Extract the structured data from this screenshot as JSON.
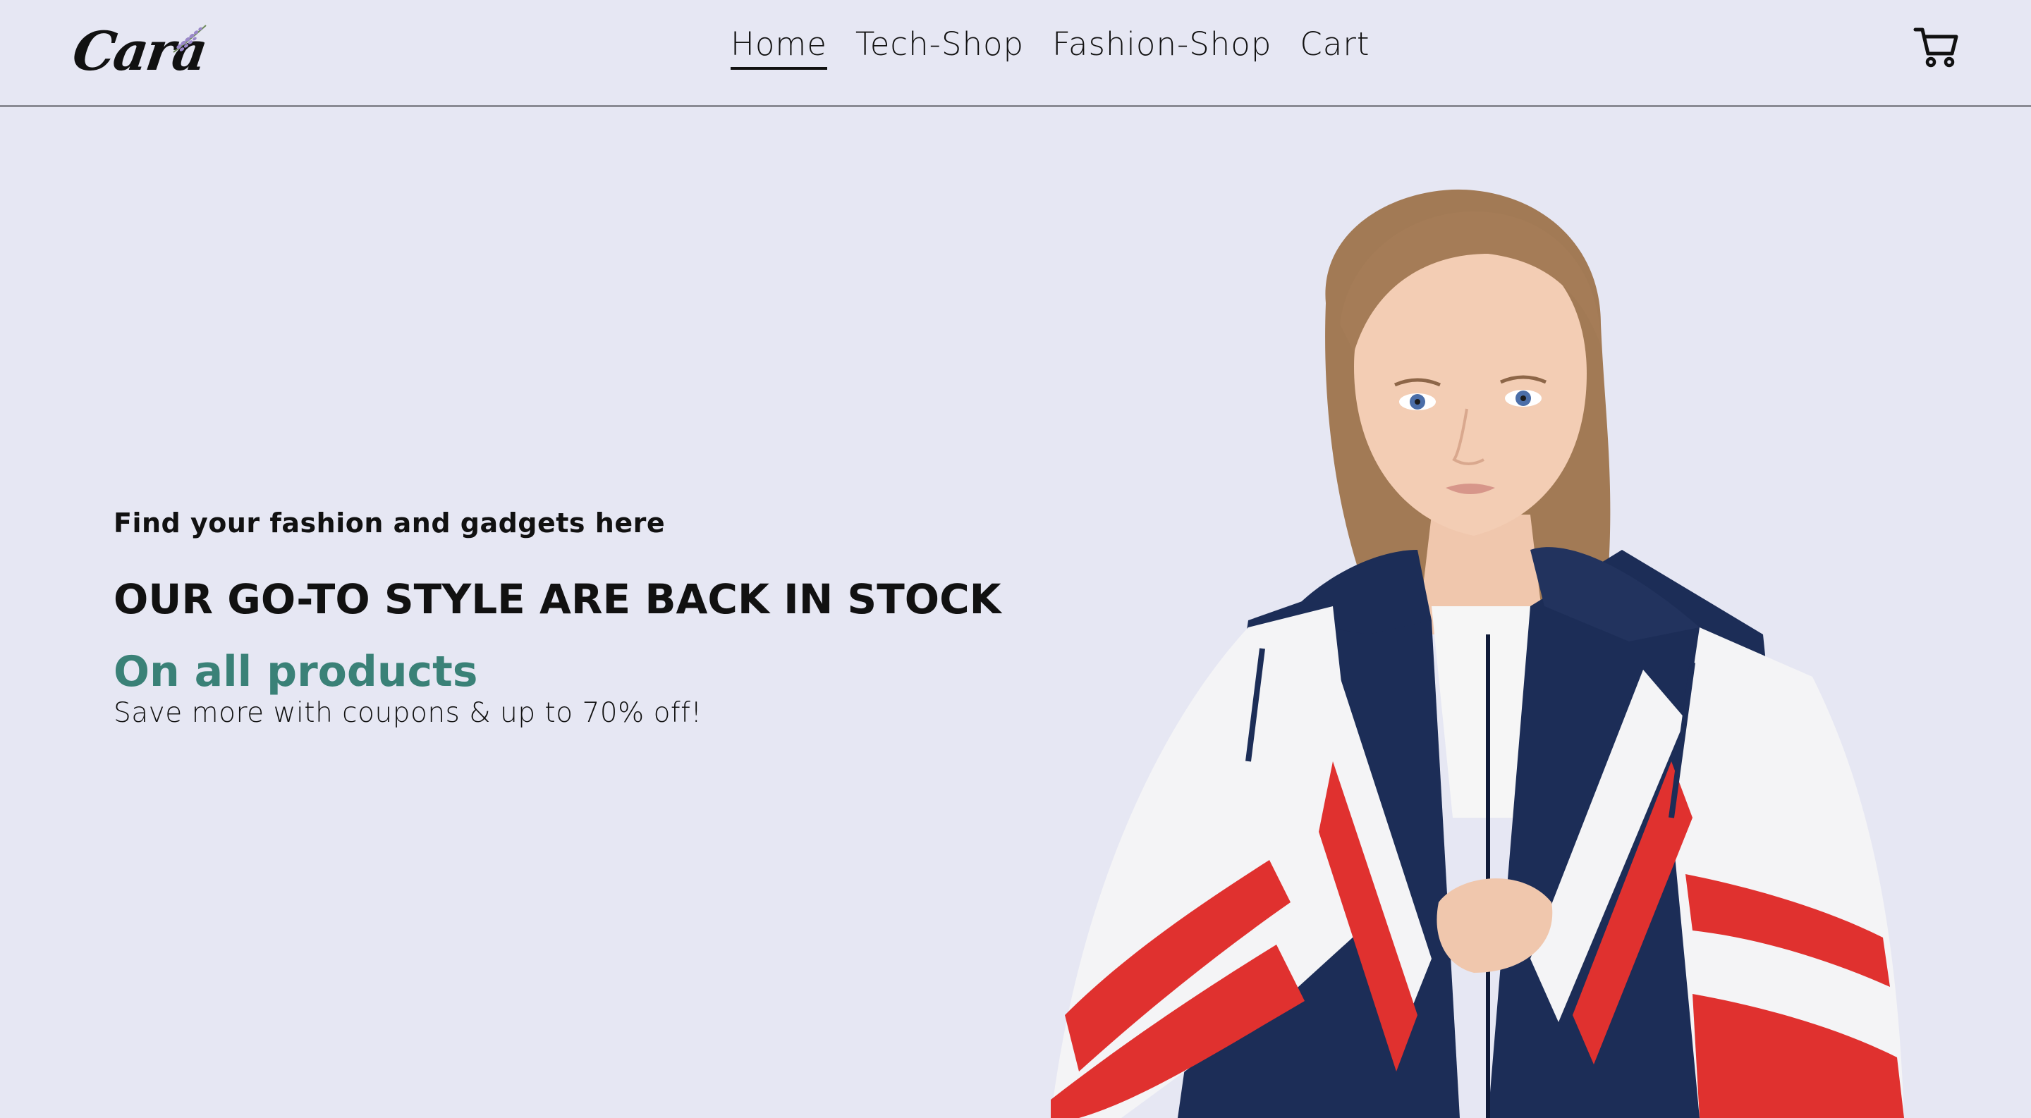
{
  "header": {
    "logo_text": "Cara",
    "nav": [
      {
        "label": "Home",
        "active": true
      },
      {
        "label": "Tech-Shop",
        "active": false
      },
      {
        "label": "Fashion-Shop",
        "active": false
      },
      {
        "label": "Cart",
        "active": false
      }
    ],
    "cart_icon": "shopping-cart-icon"
  },
  "hero": {
    "kicker": "Find your fashion and gadgets here",
    "headline": "OUR GO-TO STYLE ARE BACK IN STOCK",
    "accent": "On all products",
    "subline": "Save more with coupons & up to 70% off!",
    "image_alt": "Model wearing navy, white and red windbreaker jacket"
  },
  "colors": {
    "background": "#e6e7f3",
    "accent": "#3a8177",
    "text": "#111111",
    "jacket_navy": "#1c2d57",
    "jacket_red": "#e0312f"
  }
}
